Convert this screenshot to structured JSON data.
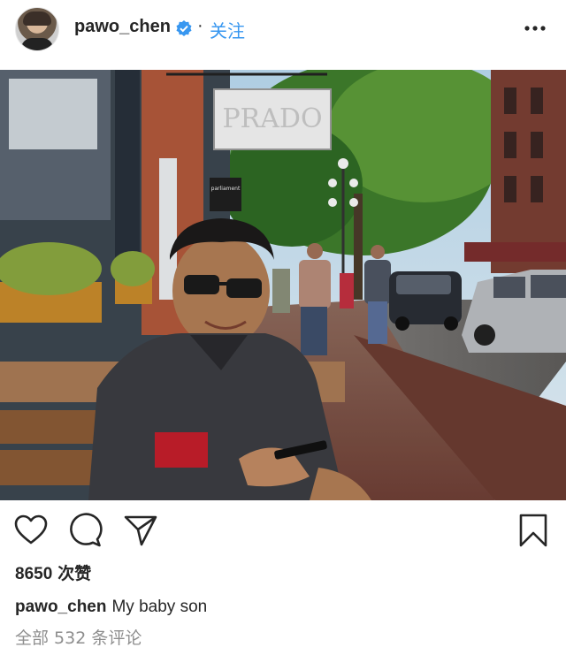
{
  "header": {
    "username": "pawo_chen",
    "separator": "·",
    "follow_label": "关注"
  },
  "post": {
    "photo_sign": "PRADO",
    "photo_shop_sign": "parliament",
    "likes_count": "8650",
    "likes_unit": "次赞",
    "caption_user": "pawo_chen",
    "caption_text": "My baby son",
    "comments_text": "全部 532 条评论"
  },
  "colors": {
    "accent": "#3897f0",
    "text": "#262626",
    "muted": "#8e8e8e"
  },
  "icons": [
    "verified-badge-icon",
    "more-options-icon",
    "heart-icon",
    "comment-icon",
    "share-icon",
    "bookmark-icon"
  ]
}
